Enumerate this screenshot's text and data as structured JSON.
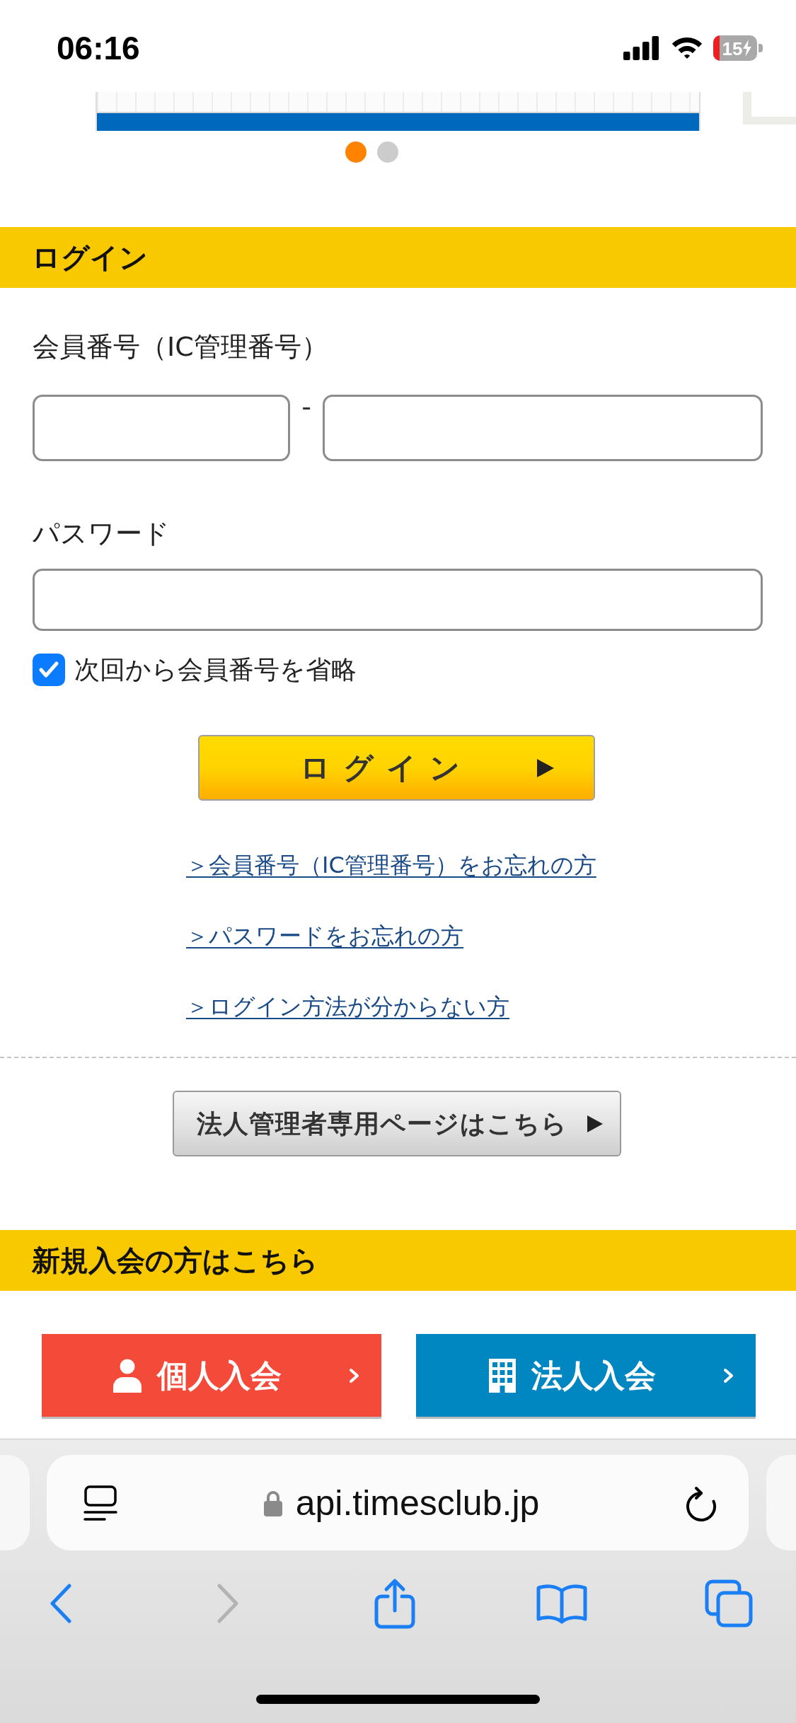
{
  "status_bar": {
    "time": "06:16",
    "battery": "15"
  },
  "carousel": {
    "dots": [
      {
        "selected": true
      },
      {
        "selected": false
      }
    ]
  },
  "login": {
    "heading": "ログイン",
    "member_number": {
      "label": "会員番号（IC管理番号）",
      "separator": "-"
    },
    "password": {
      "label": "パスワード"
    },
    "remember": {
      "label": "次回から会員番号を省略",
      "checked": true
    },
    "submit": "ログイン",
    "links": [
      "＞会員番号（IC管理番号）をお忘れの方",
      "＞パスワードをお忘れの方",
      "＞ログイン方法が分からない方"
    ],
    "corporate_admin": "法人管理者専用ページはこちら"
  },
  "signup": {
    "heading": "新規入会の方はこちら",
    "buttons": [
      {
        "kind": "personal",
        "label": "個人入会",
        "color": "#f44a3a"
      },
      {
        "kind": "corporate",
        "label": "法人入会",
        "color": "#0086c0"
      }
    ]
  },
  "browser": {
    "url": "api.timesclub.jp",
    "toolbar": [
      {
        "kind": "back",
        "disabled": false
      },
      {
        "kind": "forward",
        "disabled": true
      },
      {
        "kind": "share",
        "disabled": false
      },
      {
        "kind": "bookmarks",
        "disabled": false
      },
      {
        "kind": "tabs",
        "disabled": false
      }
    ]
  }
}
